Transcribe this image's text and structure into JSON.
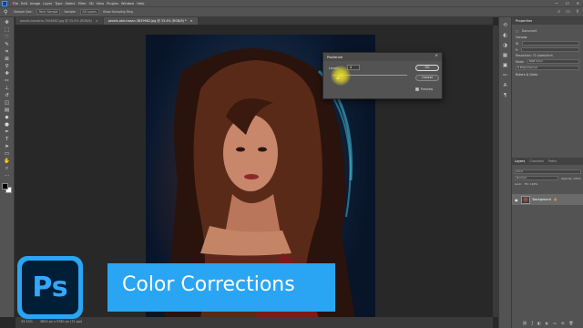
{
  "menubar": {
    "logo": "Ps",
    "items": [
      "File",
      "Edit",
      "Image",
      "Layer",
      "Type",
      "Select",
      "Filter",
      "3D",
      "View",
      "Plugins",
      "Window",
      "Help"
    ]
  },
  "window_controls": {
    "minimize": "—",
    "maximize": "☐",
    "close": "✕"
  },
  "optionsbar": {
    "sample_label": "Sample Size:",
    "sample_value": "Point Sample",
    "sample_from": "Sample:",
    "sample_from_value": "All Layers",
    "show_ring": "Show Sampling Ring"
  },
  "tabs": [
    {
      "label": "pexels-karolina-7004862.jpg @ 33.4% (RGB/8)",
      "close": "×"
    },
    {
      "label": "pexels-abir-hasan-3839962.jpg @ 33.4% (RGB/8) *",
      "close": "×"
    }
  ],
  "status": {
    "zoom": "33.33%",
    "doc": "3853 px x 5780 px (72 ppi)"
  },
  "properties": {
    "title": "Properties",
    "doc_label": "Document",
    "canvas_label": "Canvas",
    "w_label": "W",
    "h_label": "H",
    "resolution": "Resolution: 72 pixels/inch",
    "mode_label": "Mode",
    "mode_value": "RGB Color",
    "depth_value": "8 Bits/Channel",
    "rulers": "Rulers & Grids"
  },
  "layers": {
    "tabs": [
      "Layers",
      "Channels",
      "Paths"
    ],
    "kind": "Kind",
    "blend": "Normal",
    "opacity": "Opacity: 100%",
    "lock": "Lock:",
    "fill": "Fill: 100%",
    "layer_name": "Background"
  },
  "dialog": {
    "title": "Posterize",
    "levels_label": "Levels:",
    "levels_value": "4",
    "ok": "OK",
    "cancel": "Cancel",
    "preview": "Preview",
    "preview_checked": "✓"
  },
  "banner": {
    "title": "Color Corrections",
    "logo": "Ps"
  },
  "colors": {
    "brand": "#29a5f3",
    "logo_bg": "#001e36",
    "logo_text": "#31a8ff",
    "highlight": "#f0e628"
  }
}
